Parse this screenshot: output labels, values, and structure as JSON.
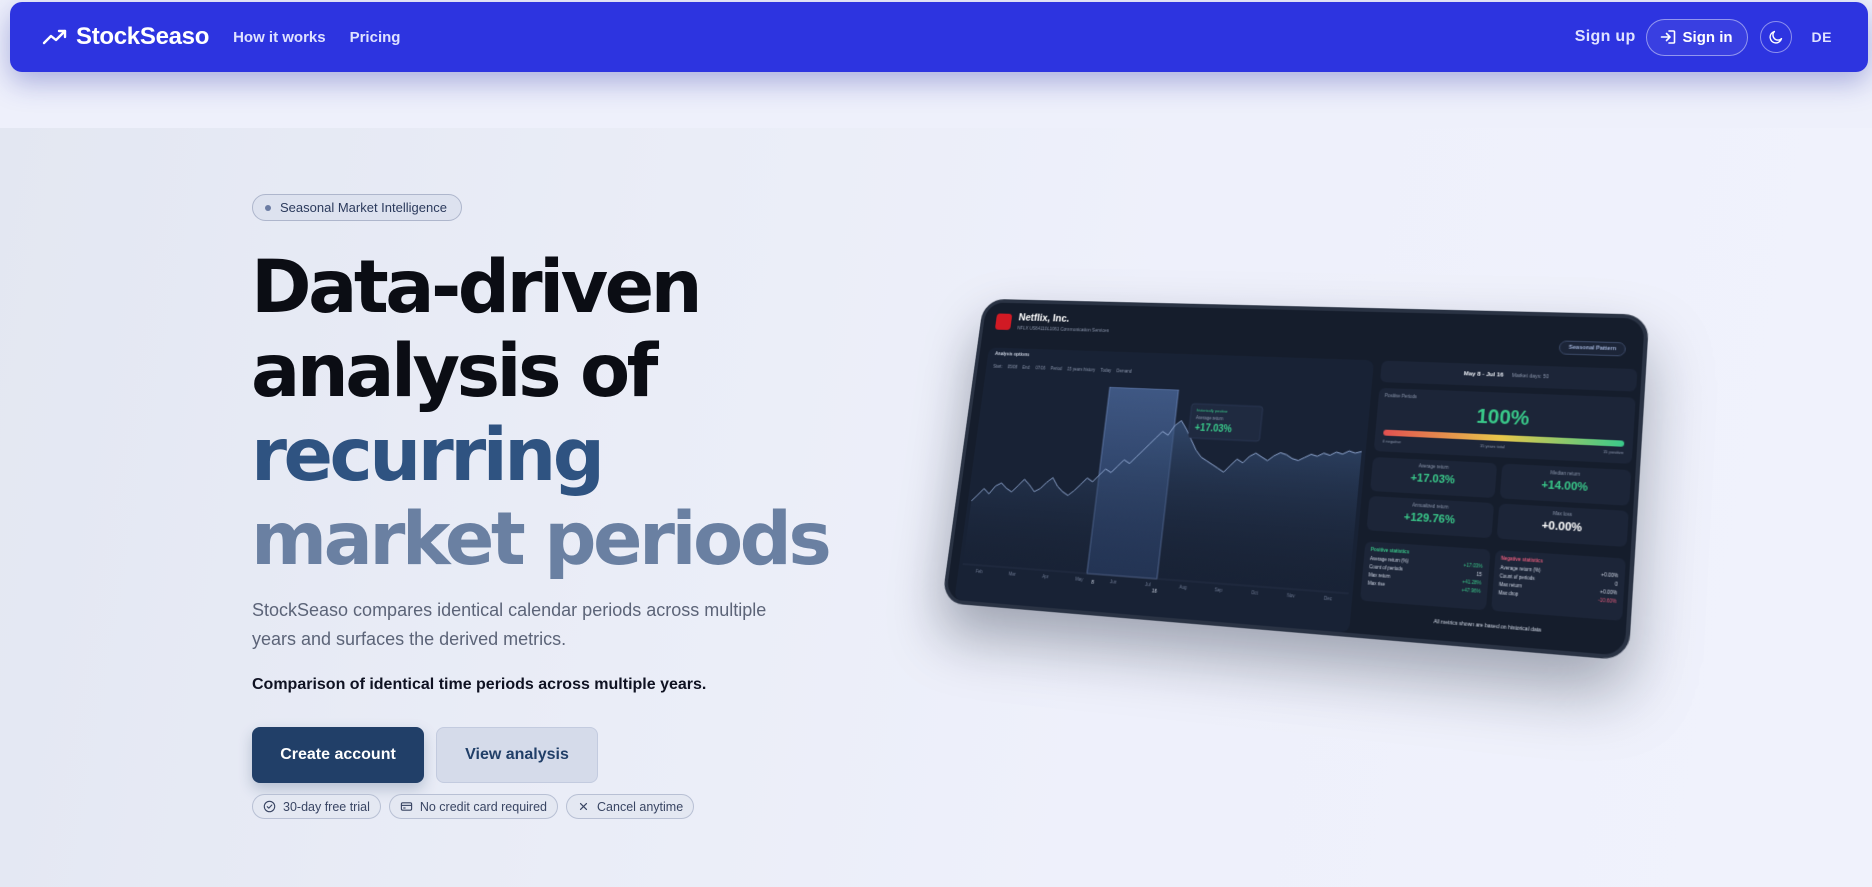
{
  "nav": {
    "brand": "StockSeaso",
    "links": [
      "How it works",
      "Pricing"
    ],
    "signup": "Sign up",
    "signin": "Sign in",
    "lang": "DE"
  },
  "hero": {
    "badge": "Seasonal Market Intelligence",
    "title_lines": [
      "Data-driven",
      "analysis of",
      "recurring",
      "market periods"
    ],
    "description": "StockSeaso compares identical calendar periods across multiple years and surfaces the derived metrics.",
    "subline": "Comparison of identical time periods across multiple years.",
    "cta_primary": "Create account",
    "cta_secondary": "View analysis",
    "chips": [
      "30-day free trial",
      "No credit card required",
      "Cancel anytime"
    ]
  },
  "mockup": {
    "company": "Netflix, Inc.",
    "meta": "NFLX   US64110L1061   Communication Services",
    "pattern_button": "Seasonal Pattern",
    "analysis_options": "Analysis options",
    "controls": [
      "Start:",
      "05/08",
      "End:",
      "07/16",
      "Period",
      "15 years history",
      "Today",
      "Demand"
    ],
    "period_range": "May 8 - Jul 16",
    "market_days": "Market days: 50",
    "positive_periods_label": "Positive Periods",
    "positive_pct": "100%",
    "negative_label": "0 negative",
    "years_label": "15 years total",
    "positive_count_label": "15 positive",
    "tooltip_badge": "historically positive",
    "tooltip_label": "Average return",
    "tooltip_value": "+17.03%",
    "tiles": [
      {
        "label": "Average return",
        "value": "+17.03%"
      },
      {
        "label": "Median return",
        "value": "+14.00%"
      },
      {
        "label": "Annualized return",
        "value": "+129.76%"
      },
      {
        "label": "Max loss",
        "value": "+0.00%"
      }
    ],
    "positive_stats": {
      "title": "Positive statistics",
      "rows": [
        [
          "Average return (%)",
          "+17.03%"
        ],
        [
          "Count of periods",
          "15"
        ],
        [
          "Max return",
          "+41.28%"
        ],
        [
          "Max rise",
          "+47.96%"
        ]
      ]
    },
    "negative_stats": {
      "title": "Negative statistics",
      "rows": [
        [
          "Average return (%)",
          "+0.00%"
        ],
        [
          "Count of periods",
          "0"
        ],
        [
          "Max return",
          "+0.00%"
        ],
        [
          "Max drop",
          "-10.60%"
        ]
      ]
    },
    "footer": "All metrics shown are based on historical data",
    "month_labels": [
      "Feb",
      "Mar",
      "Apr",
      "May",
      "Jun",
      "Jul",
      "Aug",
      "Sep",
      "Oct",
      "Nov",
      "Dec"
    ],
    "date_marks": [
      "8",
      "16"
    ],
    "chart_curve": [
      0.38,
      0.42,
      0.46,
      0.43,
      0.48,
      0.5,
      0.47,
      0.45,
      0.49,
      0.53,
      0.5,
      0.46,
      0.48,
      0.52,
      0.55,
      0.5,
      0.47,
      0.45,
      0.48,
      0.52,
      0.56,
      0.54,
      0.58,
      0.62,
      0.6,
      0.64,
      0.68,
      0.66,
      0.7,
      0.74,
      0.78,
      0.82,
      0.86,
      0.84,
      0.9,
      0.93,
      0.88,
      0.82,
      0.76,
      0.72,
      0.7,
      0.68,
      0.66,
      0.64,
      0.68,
      0.72,
      0.7,
      0.74,
      0.76,
      0.74,
      0.72,
      0.75,
      0.77,
      0.76,
      0.74,
      0.73,
      0.75,
      0.77,
      0.76,
      0.78,
      0.77,
      0.79,
      0.78,
      0.8,
      0.79,
      0.8
    ]
  },
  "colors": {
    "nav_bg": "#2d34e0",
    "primary": "#213f68",
    "accent_line3": "#2f5381",
    "accent_line4": "#6a80a2",
    "positive": "#39c98a",
    "negative": "#e25a7a"
  }
}
